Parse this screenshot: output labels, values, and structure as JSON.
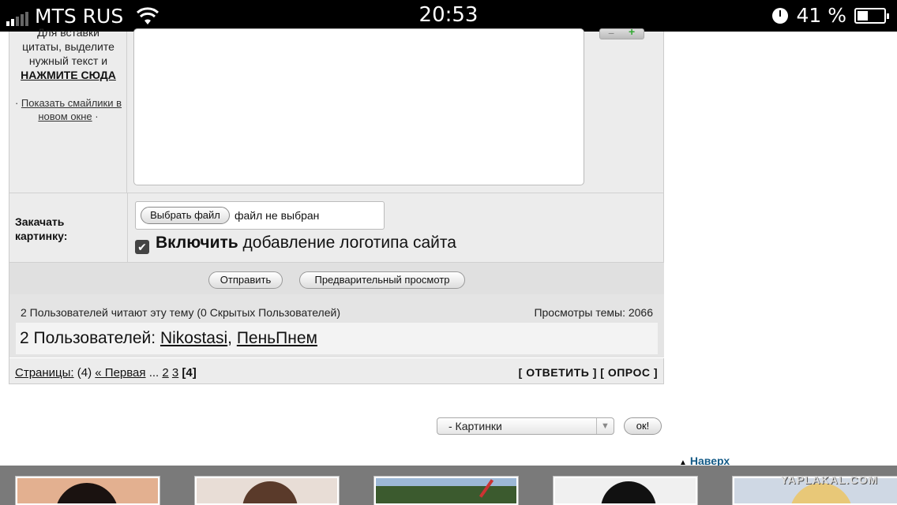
{
  "status_bar": {
    "carrier": "MTS RUS",
    "time": "20:53",
    "battery": "41 %",
    "battery_level": 0.41
  },
  "sidebar": {
    "quote_line1": "Для вставки",
    "quote_line2": "цитаты, выделите",
    "quote_line3": "нужный текст и",
    "quote_click": "НАЖМИТЕ СЮДА",
    "smiles_link": "Показать смайлики в новом окне"
  },
  "upload": {
    "label_line1": "Закачать",
    "label_line2": "картинку:",
    "choose_button": "Выбрать файл",
    "file_status": "файл не выбран",
    "checkbox_bold": "Включить",
    "checkbox_rest": "добавление логотипа сайта",
    "checkbox_checked": true
  },
  "actions": {
    "submit": "Отправить",
    "preview": "Предварительный просмотр"
  },
  "readers": {
    "summary": "2 Пользователей читают эту тему (0 Скрытых Пользователей)",
    "views": "Просмотры темы: 2066",
    "users_prefix": "2 Пользователей:",
    "user1": "Nikostasi",
    "user2": "ПеньПнем"
  },
  "pagination": {
    "label": "Страницы:",
    "count": "(4)",
    "first": "« Первая",
    "ellipsis": "...",
    "page2": "2",
    "page3": "3",
    "current": "[4]"
  },
  "reply_options": {
    "reply": "[ ОТВЕТИТЬ ]",
    "poll": "[ ОПРОС ]"
  },
  "jump": {
    "selected": "- Картинки",
    "ok": "ок!"
  },
  "to_top": "Наверх",
  "watermark": "YAPLAKAL.COM"
}
